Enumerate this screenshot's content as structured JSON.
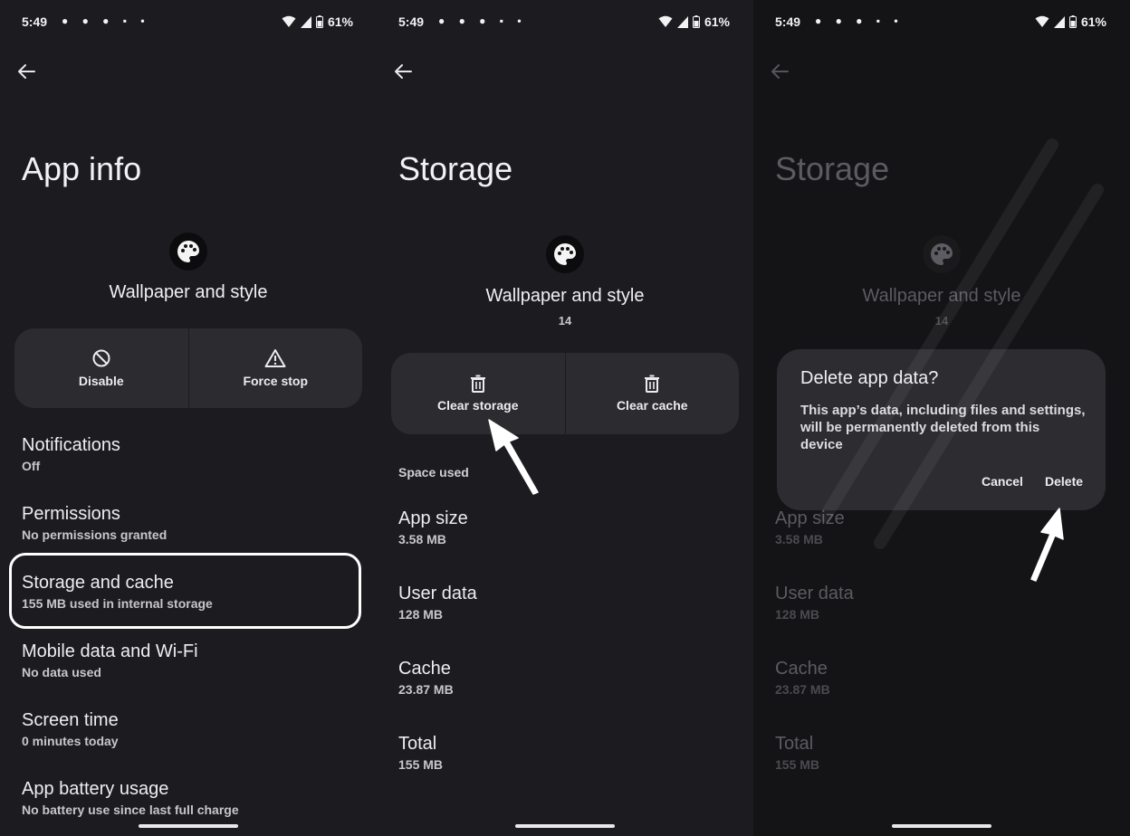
{
  "status": {
    "time": "5:49",
    "battery": "61%"
  },
  "panel1": {
    "title": "App info",
    "app_name": "Wallpaper and style",
    "buttons": {
      "disable": "Disable",
      "force_stop": "Force stop"
    },
    "items": [
      {
        "title": "Notifications",
        "subtitle": "Off"
      },
      {
        "title": "Permissions",
        "subtitle": "No permissions granted"
      },
      {
        "title": "Storage and cache",
        "subtitle": "155 MB used in internal storage"
      },
      {
        "title": "Mobile data and Wi-Fi",
        "subtitle": "No data used"
      },
      {
        "title": "Screen time",
        "subtitle": "0 minutes today"
      },
      {
        "title": "App battery usage",
        "subtitle": "No battery use since last full charge"
      }
    ]
  },
  "panel2": {
    "title": "Storage",
    "app_name": "Wallpaper and style",
    "version": "14",
    "buttons": {
      "clear_storage": "Clear storage",
      "clear_cache": "Clear cache"
    },
    "section_label": "Space used",
    "rows": [
      {
        "title": "App size",
        "value": "3.58 MB"
      },
      {
        "title": "User data",
        "value": "128 MB"
      },
      {
        "title": "Cache",
        "value": "23.87 MB"
      },
      {
        "title": "Total",
        "value": "155 MB"
      }
    ]
  },
  "panel3": {
    "dialog": {
      "title": "Delete app data?",
      "body": "This app’s data, including files and settings, will be permanently deleted from this device",
      "cancel": "Cancel",
      "delete": "Delete"
    }
  },
  "colors": {
    "background": "#1c1c20",
    "button_bar": "#2b2b30",
    "dialog": "#2c2c31",
    "highlight": "#ffffff"
  },
  "icons": [
    "back-arrow-icon",
    "palette-icon",
    "disable-icon",
    "warning-icon",
    "trash-icon",
    "wifi-icon",
    "signal-icon",
    "battery-icon",
    "pointer-arrow-icon"
  ]
}
